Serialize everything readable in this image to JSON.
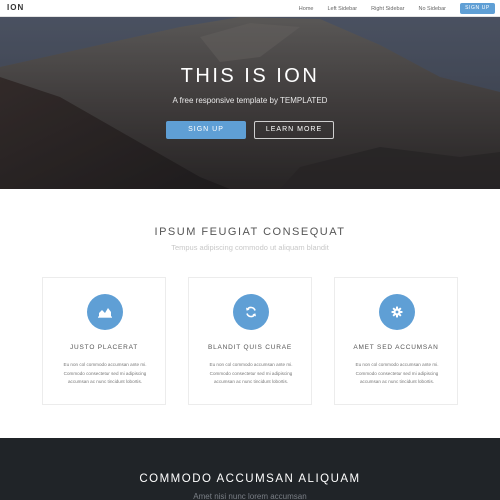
{
  "header": {
    "logo": "ION",
    "nav": [
      {
        "label": "Home"
      },
      {
        "label": "Left Sidebar"
      },
      {
        "label": "Right Sidebar"
      },
      {
        "label": "No Sidebar"
      }
    ],
    "signup_label": "SIGN UP"
  },
  "banner": {
    "title": "THIS IS ION",
    "subtitle": "A free responsive template by TEMPLATED",
    "primary_button": "SIGN UP",
    "secondary_button": "LEARN MORE"
  },
  "features": {
    "title": "IPSUM FEUGIAT CONSEQUAT",
    "subtitle": "Tempus adipiscing commodo ut aliquam blandit",
    "cards": [
      {
        "icon": "area-chart-icon",
        "title": "JUSTO PLACERAT",
        "text": "Eu non col commodo accumsan ante mi. Commodo consectetur sed mi adipiscing accumsan ac nunc tincidunt lobortis."
      },
      {
        "icon": "refresh-icon",
        "title": "BLANDIT QUIS CURAE",
        "text": "Eu non col commodo accumsan ante mi. Commodo consectetur sed mi adipiscing accumsan ac nunc tincidunt lobortis."
      },
      {
        "icon": "cog-icon",
        "title": "AMET SED ACCUMSAN",
        "text": "Eu non col commodo accumsan ante mi. Commodo consectetur sed mi adipiscing accumsan ac nunc tincidunt lobortis."
      }
    ]
  },
  "cta": {
    "title": "COMMODO ACCUMSAN ALIQUAM",
    "subtitle": "Amet nisi nunc lorem accumsan"
  },
  "colors": {
    "accent": "#5f9fd5",
    "dark_section": "#202428",
    "header_bg": "#ffffff"
  }
}
